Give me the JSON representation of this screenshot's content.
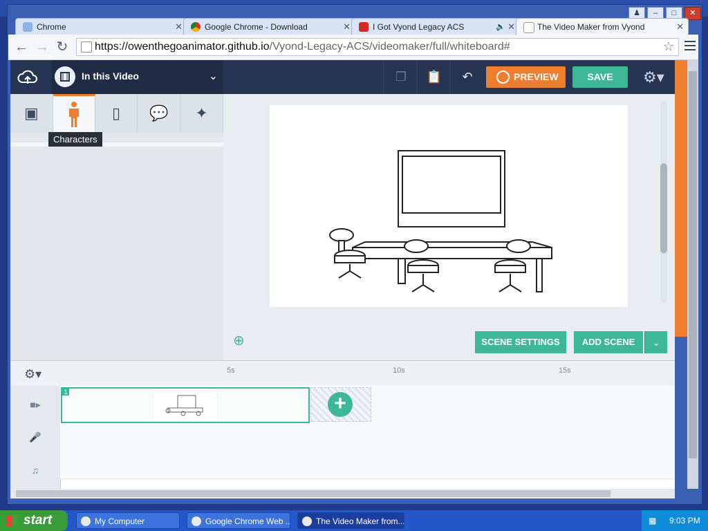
{
  "browser": {
    "tabs": [
      {
        "title": "Chrome",
        "favicon_color": "#8fb3e6"
      },
      {
        "title": "Google Chrome - Download",
        "favicon_color": "#e2a23a"
      },
      {
        "title": "I Got Vyond Legacy ACS",
        "favicon_color": "#d32c26"
      },
      {
        "title": "The Video Maker from Vyond",
        "favicon_color": "#e7ebf2"
      }
    ],
    "url_host": "https://owenthegoanimator.github.io",
    "url_path": "/Vyond-Legacy-ACS/videomaker/full/whiteboard#"
  },
  "app": {
    "drop_label": "In this Video",
    "preview_label": "PREVIEW",
    "save_label": "SAVE",
    "tooltip": "Characters",
    "scene_settings_label": "SCENE SETTINGS",
    "add_scene_label": "ADD SCENE",
    "scene_number": "1",
    "ruler_ticks": [
      "5s",
      "10s",
      "15s"
    ]
  },
  "taskbar": {
    "start_label": "start",
    "tasks": [
      "My Computer",
      "Google Chrome Web ...",
      "The Video Maker from..."
    ],
    "clock": "9:03 PM"
  },
  "colors": {
    "accent_orange": "#ee7d2d",
    "accent_green": "#3db897",
    "topbar": "#283552"
  }
}
